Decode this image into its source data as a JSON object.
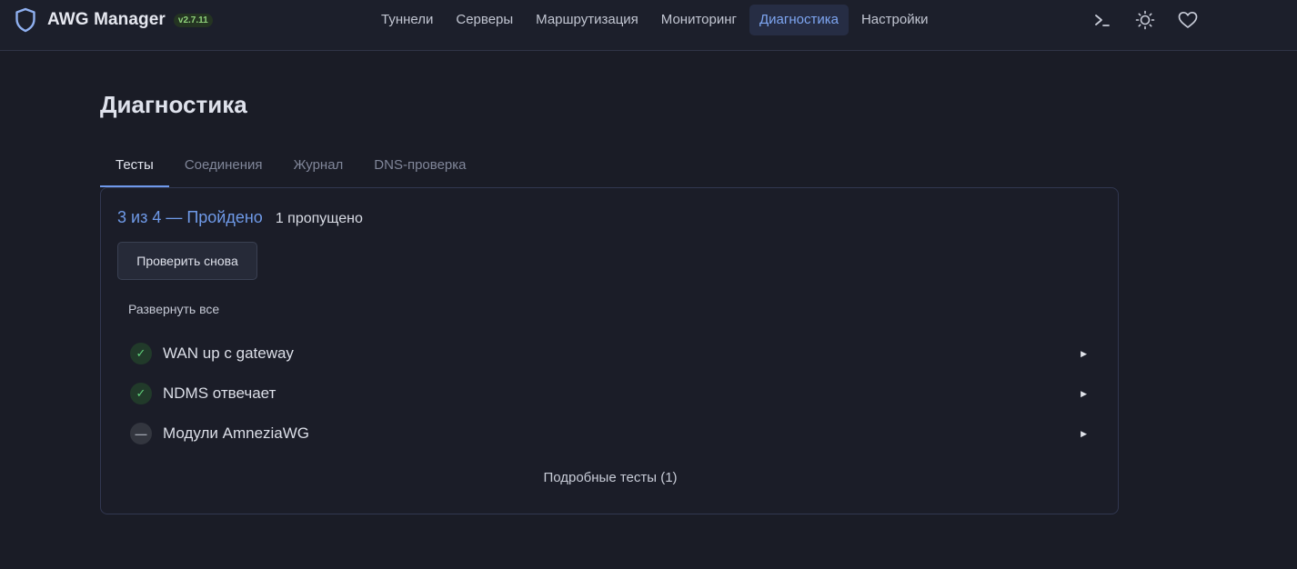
{
  "app": {
    "name": "AWG Manager",
    "version": "v2.7.11",
    "accent_color": "#7ea6f2"
  },
  "nav": {
    "items": [
      {
        "label": "Туннели"
      },
      {
        "label": "Серверы"
      },
      {
        "label": "Маршрутизация"
      },
      {
        "label": "Мониторинг"
      },
      {
        "label": "Диагностика",
        "active": true
      },
      {
        "label": "Настройки"
      }
    ]
  },
  "top_icons": [
    "terminal-icon",
    "sun-icon",
    "heart-icon"
  ],
  "page": {
    "title": "Диагностика"
  },
  "tabs": [
    {
      "label": "Тесты",
      "active": true
    },
    {
      "label": "Соединения"
    },
    {
      "label": "Журнал"
    },
    {
      "label": "DNS-проверка"
    }
  ],
  "results": {
    "summary": "3 из 4 — Пройдено",
    "skipped": "1 пропущено",
    "retry_label": "Проверить снова",
    "expand_all_label": "Развернуть все",
    "tests": [
      {
        "name": "WAN up с gateway",
        "status": "pass",
        "status_icon": "check-icon",
        "symbol": "✓"
      },
      {
        "name": "NDMS отвечает",
        "status": "pass",
        "status_icon": "check-icon",
        "symbol": "✓"
      },
      {
        "name": "Модули AmneziaWG",
        "status": "skip",
        "status_icon": "dash-icon",
        "symbol": "—"
      }
    ],
    "detailed_tests_label": "Подробные тесты (1)"
  }
}
